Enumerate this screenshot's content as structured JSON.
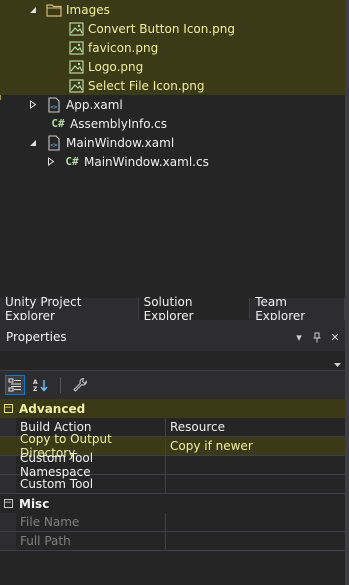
{
  "tree": {
    "items": [
      {
        "label": "Images",
        "arrow": "◢",
        "icon": "folder-icon"
      },
      {
        "label": "Convert Button Icon.png",
        "icon": "image-icon"
      },
      {
        "label": "favicon.png",
        "icon": "image-icon"
      },
      {
        "label": "Logo.png",
        "icon": "image-icon"
      },
      {
        "label": "Select File Icon.png",
        "icon": "image-icon"
      },
      {
        "label": "App.xaml",
        "arrow": "▷",
        "icon": "xaml-icon"
      },
      {
        "label": "AssemblyInfo.cs",
        "icon": "csharp-icon",
        "icon_text": "C#"
      },
      {
        "label": "MainWindow.xaml",
        "arrow": "◢",
        "icon": "xaml-icon"
      },
      {
        "label": "MainWindow.xaml.cs",
        "arrow": "▷",
        "icon": "csharp-icon",
        "icon_text": "C#"
      }
    ]
  },
  "tabs": [
    {
      "label": "Unity Project Explorer"
    },
    {
      "label": "Solution Explorer",
      "active": true
    },
    {
      "label": "Team Explorer"
    }
  ],
  "properties": {
    "title": "Properties",
    "header_buttons": {
      "dropdown": "▾",
      "pin": "⊥",
      "close": "✕"
    },
    "object_selector_arrow": "▾",
    "categories": [
      {
        "label": "Advanced",
        "toggle": "−",
        "props": [
          {
            "name": "Build Action",
            "value": "Resource"
          },
          {
            "name": "Copy to Output Directory",
            "value": "Copy if newer"
          },
          {
            "name": "Custom Tool Namespace",
            "value": ""
          },
          {
            "name": "Custom Tool",
            "value": ""
          }
        ]
      },
      {
        "label": "Misc",
        "toggle": "−",
        "props": [
          {
            "name": "File Name",
            "value": ""
          },
          {
            "name": "Full Path",
            "value": ""
          }
        ]
      }
    ]
  },
  "colors": {
    "background": "#252526",
    "selection_highlight": "#3a3a16",
    "selection_text": "#f1f1a0",
    "accent": "#007acc"
  }
}
